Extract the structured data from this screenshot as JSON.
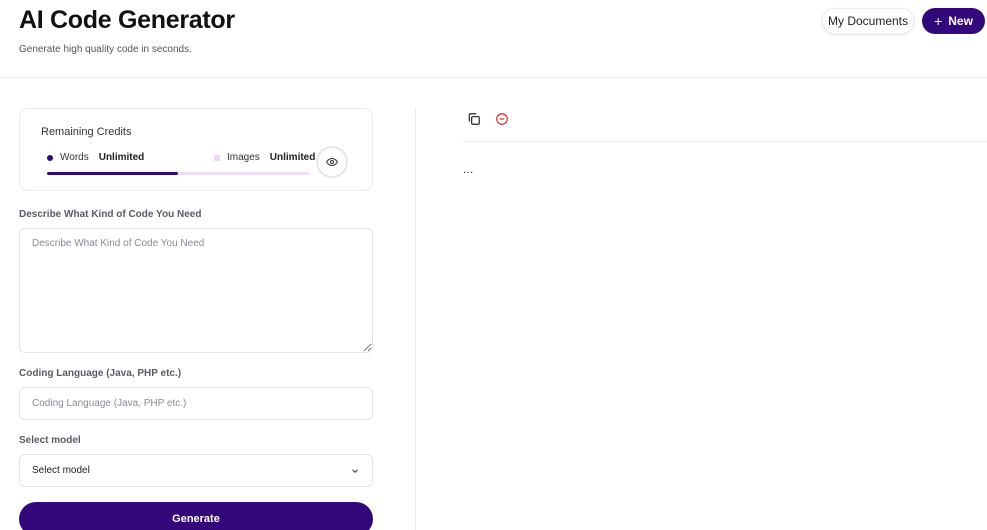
{
  "header": {
    "title": "AI Code Generator",
    "subtitle": "Generate high quality code in seconds.",
    "my_documents_label": "My Documents",
    "new_label": "New"
  },
  "credits": {
    "title": "Remaining Credits",
    "words_label": "Words",
    "words_value": "Unlimited",
    "images_label": "Images",
    "images_value": "Unlimited",
    "usage_fraction": 0.5
  },
  "form": {
    "description_label": "Describe What Kind of Code You Need",
    "description_placeholder": "Describe What Kind of Code You Need",
    "language_label": "Coding Language (Java, PHP etc.)",
    "language_placeholder": "Coding Language (Java, PHP etc.)",
    "model_label": "Select model",
    "model_selected": "Select model",
    "generate_label": "Generate"
  },
  "output": {
    "text": "..."
  },
  "colors": {
    "accent": "#33087a",
    "accent_light": "#efddf7",
    "danger": "#e02424"
  }
}
